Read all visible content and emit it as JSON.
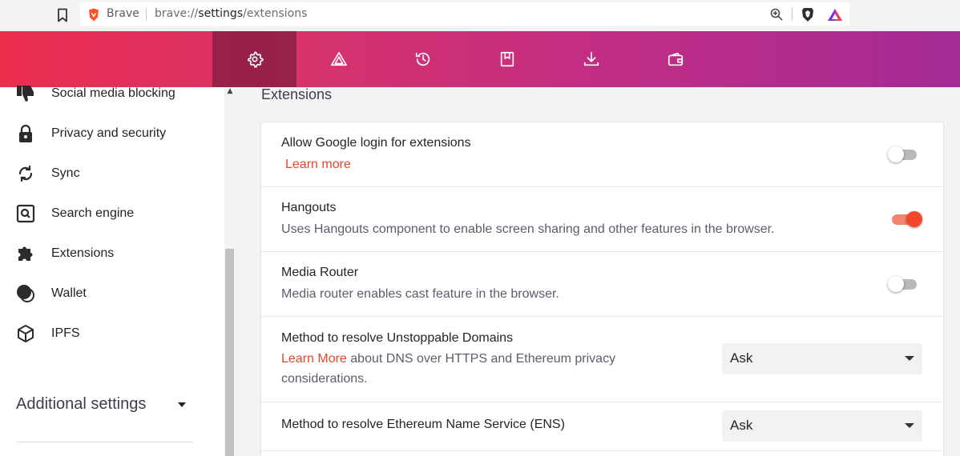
{
  "browser": {
    "brand": "Brave",
    "url_prefix": "brave://",
    "url_host": "settings",
    "url_path": "/extensions"
  },
  "nav": {
    "tabs": [
      {
        "icon": "gear-icon",
        "active": true
      },
      {
        "icon": "brave-rewards-icon",
        "active": false
      },
      {
        "icon": "history-icon",
        "active": false
      },
      {
        "icon": "bookmarks-icon",
        "active": false
      },
      {
        "icon": "download-icon",
        "active": false
      },
      {
        "icon": "wallet-icon",
        "active": false
      }
    ]
  },
  "sidebar": {
    "items": [
      {
        "label": "Social media blocking",
        "icon": "thumbs-down-icon"
      },
      {
        "label": "Privacy and security",
        "icon": "lock-icon"
      },
      {
        "label": "Sync",
        "icon": "sync-icon"
      },
      {
        "label": "Search engine",
        "icon": "search-engine-icon"
      },
      {
        "label": "Extensions",
        "icon": "puzzle-icon"
      },
      {
        "label": "Wallet",
        "icon": "wallet-icon"
      },
      {
        "label": "IPFS",
        "icon": "ipfs-cube-icon"
      }
    ],
    "additional_settings": "Additional settings"
  },
  "main": {
    "section_title": "Extensions",
    "rows": [
      {
        "title": "Allow Google login for extensions",
        "link": "Learn more",
        "toggle": false
      },
      {
        "title": "Hangouts",
        "desc": "Uses Hangouts component to enable screen sharing and other features in the browser.",
        "toggle": true
      },
      {
        "title": "Media Router",
        "desc": "Media router enables cast feature in the browser.",
        "toggle": false
      },
      {
        "title": "Method to resolve Unstoppable Domains",
        "link": "Learn More",
        "desc_line1_rest": " about DNS over HTTPS and Ethereum privacy",
        "desc_line2": "considerations.",
        "select": "Ask"
      },
      {
        "title": "Method to resolve Ethereum Name Service (ENS)",
        "select": "Ask"
      }
    ]
  },
  "colors": {
    "accent": "#e2452c",
    "toggle_on": "#f4472b",
    "nav_gradient_start": "#ec2d4e",
    "nav_gradient_end": "#a42b95"
  }
}
